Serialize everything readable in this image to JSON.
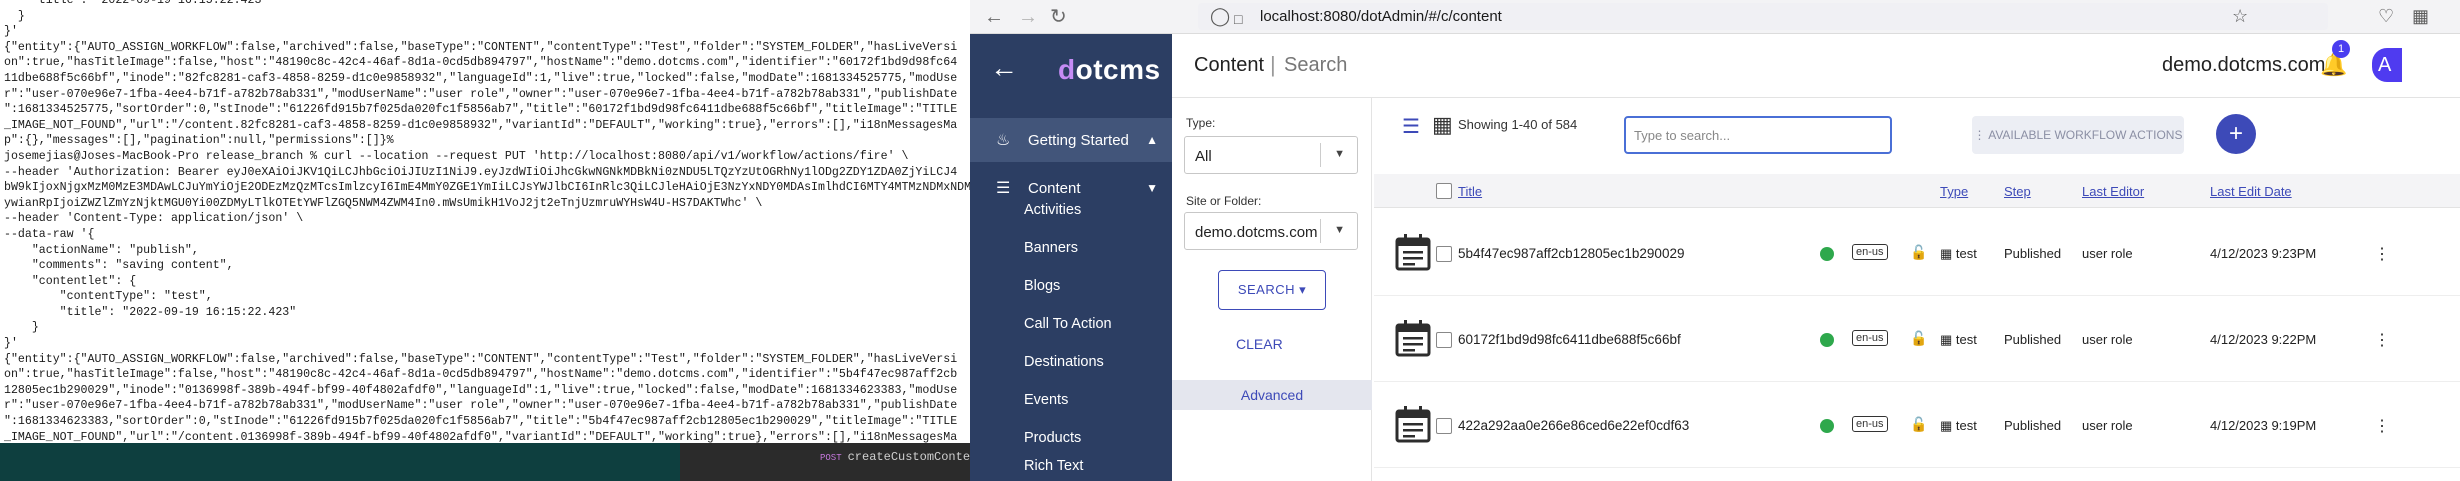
{
  "terminal": {
    "lines": [
      "    \"title\": \"2022-09-19 16:15:22.423\"",
      "  }",
      "}'",
      "{\"entity\":{\"AUTO_ASSIGN_WORKFLOW\":false,\"archived\":false,\"baseType\":\"CONTENT\",\"contentType\":\"Test\",\"folder\":\"SYSTEM_FOLDER\",\"hasLiveVersi",
      "on\":true,\"hasTitleImage\":false,\"host\":\"48190c8c-42c4-46af-8d1a-0cd5db894797\",\"hostName\":\"demo.dotcms.com\",\"identifier\":\"60172f1bd9d98fc64",
      "11dbe688f5c66bf\",\"inode\":\"82fc8281-caf3-4858-8259-d1c0e9858932\",\"languageId\":1,\"live\":true,\"locked\":false,\"modDate\":1681334525775,\"modUse",
      "r\":\"user-070e96e7-1fba-4ee4-b71f-a782b78ab331\",\"modUserName\":\"user role\",\"owner\":\"user-070e96e7-1fba-4ee4-b71f-a782b78ab331\",\"publishDate",
      "\":1681334525775,\"sortOrder\":0,\"stInode\":\"61226fd915b7f025da020fc1f5856ab7\",\"title\":\"60172f1bd9d98fc6411dbe688f5c66bf\",\"titleImage\":\"TITLE",
      "_IMAGE_NOT_FOUND\",\"url\":\"/content.82fc8281-caf3-4858-8259-d1c0e9858932\",\"variantId\":\"DEFAULT\",\"working\":true},\"errors\":[],\"i18nMessagesMa",
      "p\":{},\"messages\":[],\"pagination\":null,\"permissions\":[]}%",
      "josemejias@Joses-MacBook-Pro release_branch % curl --location --request PUT 'http://localhost:8080/api/v1/workflow/actions/fire' \\",
      "--header 'Authorization: Bearer eyJ0eXAiOiJKV1QiLCJhbGciOiJIUzI1NiJ9.eyJzdWIiOiJhcGkwNGNkMDBkNi0zNDU5LTQzYzUtOGRhNy1lODg2ZDY1ZDA0ZjYiLCJ4",
      "bW9kIjoxNjgxMzM0MzE3MDAwLCJuYmYiOjE2ODEzMzQzMTcsImlzcyI6ImE4MmY0ZGE1YmIiLCJsYWJlbCI6InRlc3QiLCJleHAiOjE3NzYxNDY0MDAsImlhdCI6MTY4MTMzNDMxNDMxN",
      "ywianRpIjoiZWZlZmYzNjktMGU0Yi00ZDMyLTlkOTEtYWFlZGQ5NWM4ZWM4In0.mWsUmikH1VoJ2jt2eTnjUzmruWYHsW4U-HS7DAKTWhc' \\",
      "--header 'Content-Type: application/json' \\",
      "--data-raw '{",
      "    \"actionName\": \"publish\",",
      "    \"comments\": \"saving content\",",
      "    \"contentlet\": {",
      "        \"contentType\": \"test\",",
      "        \"title\": \"2022-09-19 16:15:22.423\"",
      "    }",
      "}'",
      "{\"entity\":{\"AUTO_ASSIGN_WORKFLOW\":false,\"archived\":false,\"baseType\":\"CONTENT\",\"contentType\":\"Test\",\"folder\":\"SYSTEM_FOLDER\",\"hasLiveVersi",
      "on\":true,\"hasTitleImage\":false,\"host\":\"48190c8c-42c4-46af-8d1a-0cd5db894797\",\"hostName\":\"demo.dotcms.com\",\"identifier\":\"5b4f47ec987aff2cb",
      "12805ec1b290029\",\"inode\":\"0136998f-389b-494f-bf99-40f4802afdf0\",\"languageId\":1,\"live\":true,\"locked\":false,\"modDate\":1681334623383,\"modUse",
      "r\":\"user-070e96e7-1fba-4ee4-b71f-a782b78ab331\",\"modUserName\":\"user role\",\"owner\":\"user-070e96e7-1fba-4ee4-b71f-a782b78ab331\",\"publishDate",
      "\":1681334623383,\"sortOrder\":0,\"stInode\":\"61226fd915b7f025da020fc1f5856ab7\",\"title\":\"5b4f47ec987aff2cb12805ec1b290029\",\"titleImage\":\"TITLE",
      "_IMAGE_NOT_FOUND\",\"url\":\"/content.0136998f-389b-494f-bf99-40f4802afdf0\",\"variantId\":\"DEFAULT\",\"working\":true},\"errors\":[],\"i18nMessagesMa",
      "p\":{},\"messages\":[],\"pagination\":null,\"permissions\":[]}%",
      "josemejias@Joses-MacBook-Pro release_branch % ▎"
    ]
  },
  "editor": {
    "keyword": "POST",
    "text": "createCustomContent"
  },
  "browser": {
    "url": "localhost:8080/dotAdmin/#/c/content",
    "back_icon": "arrow-left-icon",
    "forward_icon": "arrow-right-icon",
    "reload_icon": "reload-icon"
  },
  "sidebar": {
    "logo": "dotcms",
    "sections": [
      {
        "label": "Getting Started",
        "icon": "flame-icon"
      },
      {
        "label": "Content",
        "icon": "list-icon"
      }
    ],
    "items": [
      "Activities",
      "Banners",
      "Blogs",
      "Call To Action",
      "Destinations",
      "Events",
      "Products",
      "Rich Text"
    ]
  },
  "header": {
    "crumb1": "Content",
    "crumb2": "Search",
    "site": "demo.dotcms.com",
    "notifications": "1",
    "avatar": "A"
  },
  "filters": {
    "type_label": "Type:",
    "type_value": "All",
    "site_label": "Site or Folder:",
    "site_value": "demo.dotcms.com",
    "search_button": "SEARCH",
    "clear_button": "CLEAR",
    "advanced": "Advanced"
  },
  "results": {
    "showing": "Showing 1-40 of 584",
    "search_placeholder": "Type to search...",
    "workflow_button": "⋮  AVAILABLE WORKFLOW ACTIONS",
    "add_button": "+",
    "columns": [
      "Title",
      "Type",
      "Step",
      "Last Editor",
      "Last Edit Date"
    ],
    "rows": [
      {
        "title": "5b4f47ec987aff2cb12805ec1b290029",
        "lang": "en-us",
        "type": "test",
        "step": "Published",
        "editor": "user role",
        "date": "4/12/2023 9:23PM"
      },
      {
        "title": "60172f1bd9d98fc6411dbe688f5c66bf",
        "lang": "en-us",
        "type": "test",
        "step": "Published",
        "editor": "user role",
        "date": "4/12/2023 9:22PM"
      },
      {
        "title": "422a292aa0e266e86ced6e22ef0cdf63",
        "lang": "en-us",
        "type": "test",
        "step": "Published",
        "editor": "user role",
        "date": "4/12/2023 9:19PM"
      }
    ]
  }
}
